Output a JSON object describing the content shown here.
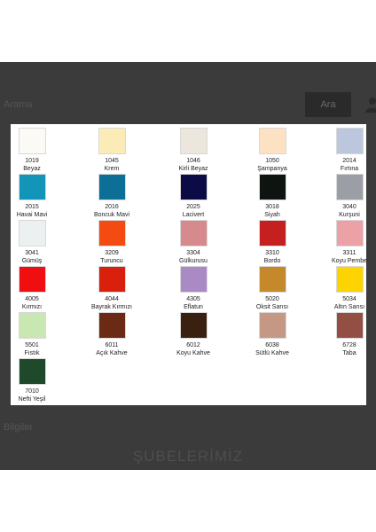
{
  "background": {
    "search_text": "Arama",
    "search_button": "Ara",
    "footer_text": "Bilgiler",
    "section_title": "ŞUBELERİMİZ"
  },
  "colors": [
    {
      "code": "1019",
      "name": "Beyaz",
      "hex": "#fbfaf5"
    },
    {
      "code": "1045",
      "name": "Krem",
      "hex": "#fbecb7"
    },
    {
      "code": "1046",
      "name": "Kirli Beyaz",
      "hex": "#ece6dc"
    },
    {
      "code": "1050",
      "name": "Şampanya",
      "hex": "#fce2c3"
    },
    {
      "code": "2014",
      "name": "Fırtına",
      "hex": "#bcc6dc"
    },
    {
      "code": "2015",
      "name": "Havai Mavi",
      "hex": "#1395b9"
    },
    {
      "code": "2016",
      "name": "Boncuk Mavi",
      "hex": "#0e6f96"
    },
    {
      "code": "2025",
      "name": "Lacivert",
      "hex": "#0d0b45"
    },
    {
      "code": "3018",
      "name": "Siyah",
      "hex": "#0e1510"
    },
    {
      "code": "3040",
      "name": "Kurşuni",
      "hex": "#9b9ea5"
    },
    {
      "code": "3041",
      "name": "Gümüş",
      "hex": "#edf0f1"
    },
    {
      "code": "3209",
      "name": "Turuncu",
      "hex": "#f34b12"
    },
    {
      "code": "3304",
      "name": "Gülkurusu",
      "hex": "#d78a8e"
    },
    {
      "code": "3310",
      "name": "Bordo",
      "hex": "#c3201f"
    },
    {
      "code": "3311",
      "name": "Koyu Pembe",
      "hex": "#eba1a6"
    },
    {
      "code": "4005",
      "name": "Kırmızı",
      "hex": "#f00e10"
    },
    {
      "code": "4044",
      "name": "Bayrak Kırmızı",
      "hex": "#d8200d"
    },
    {
      "code": "4305",
      "name": "Eflatun",
      "hex": "#a98ac4"
    },
    {
      "code": "5020",
      "name": "Oksit Sarısı",
      "hex": "#c5892c"
    },
    {
      "code": "5034",
      "name": "Altın Sarısı",
      "hex": "#fed302"
    },
    {
      "code": "5501",
      "name": "Fıstık",
      "hex": "#c8e7b1"
    },
    {
      "code": "6011",
      "name": "Açık Kahve",
      "hex": "#6a2a14"
    },
    {
      "code": "6012",
      "name": "Koyu Kahve",
      "hex": "#3a2011"
    },
    {
      "code": "6038",
      "name": "Sütlü Kahve",
      "hex": "#c49885"
    },
    {
      "code": "6728",
      "name": "Taba",
      "hex": "#944f45"
    },
    {
      "code": "7010",
      "name": "Nefti Yeşil",
      "hex": "#1e4a2b"
    }
  ]
}
